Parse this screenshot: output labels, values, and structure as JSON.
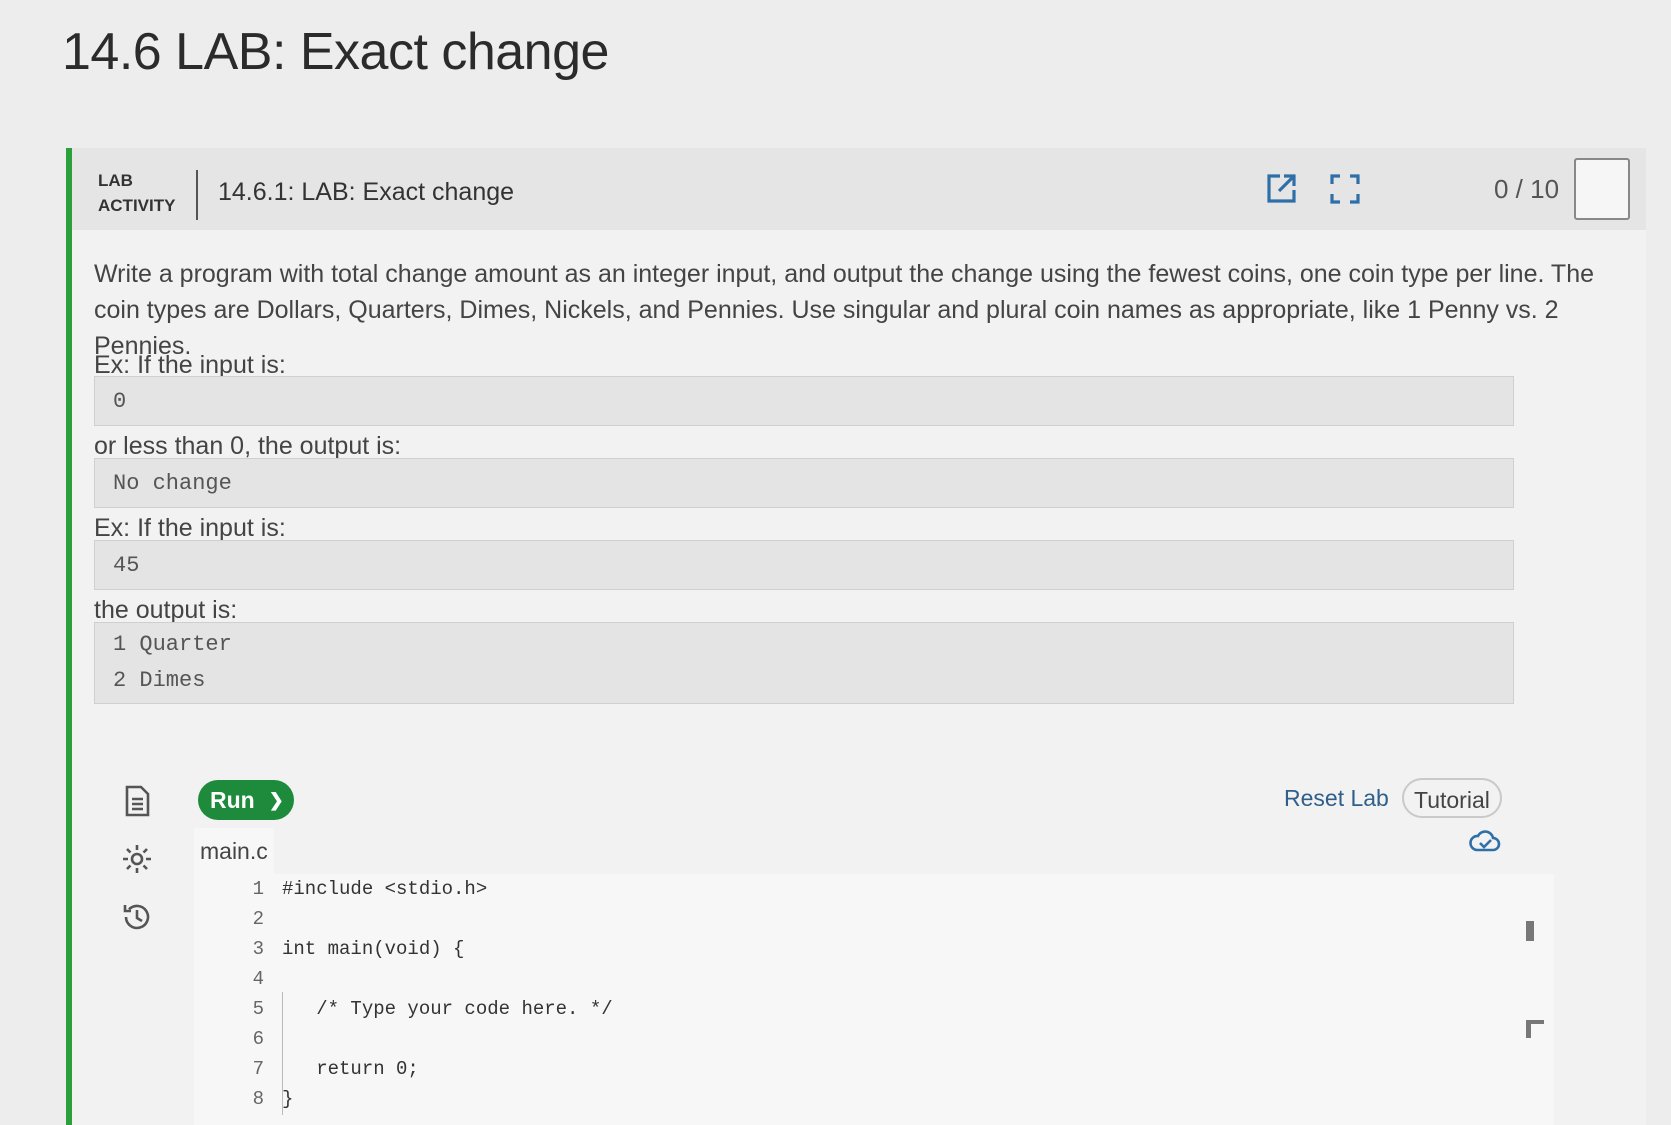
{
  "page": {
    "title": "14.6 LAB: Exact change"
  },
  "header": {
    "badge_line1": "LAB",
    "badge_line2": "ACTIVITY",
    "lab_name": "14.6.1: LAB: Exact change",
    "score": "0 / 10"
  },
  "description": "Write a program with total change amount as an integer input, and output the change using the fewest coins, one coin type per line. The coin types are Dollars, Quarters, Dimes, Nickels, and Pennies. Use singular and plural coin names as appropriate, like 1 Penny vs. 2 Pennies.",
  "examples": {
    "ex1_label": "Ex: If the input is:",
    "ex1_input": "0",
    "ex1_output_label": "or less than 0, the output is:",
    "ex1_output": "No change",
    "ex2_label": "Ex: If the input is:",
    "ex2_input": "45",
    "ex2_output_label": "the output is:",
    "ex2_output_lines": [
      "1 Quarter",
      "2 Dimes"
    ]
  },
  "toolbar": {
    "run_label": "Run",
    "reset_label": "Reset Lab",
    "tutorial_label": "Tutorial"
  },
  "editor": {
    "file_name": "main.c",
    "line_numbers": [
      "1",
      "2",
      "3",
      "4",
      "5",
      "6",
      "7",
      "8"
    ],
    "lines": [
      "#include <stdio.h>",
      "",
      "int main(void) {",
      "",
      "   /* Type your code here. */",
      "",
      "   return 0;",
      "}"
    ]
  },
  "colors": {
    "accent_green": "#2c9f3d",
    "run_green": "#1d8a3c",
    "icon_blue": "#2f6fa8"
  }
}
